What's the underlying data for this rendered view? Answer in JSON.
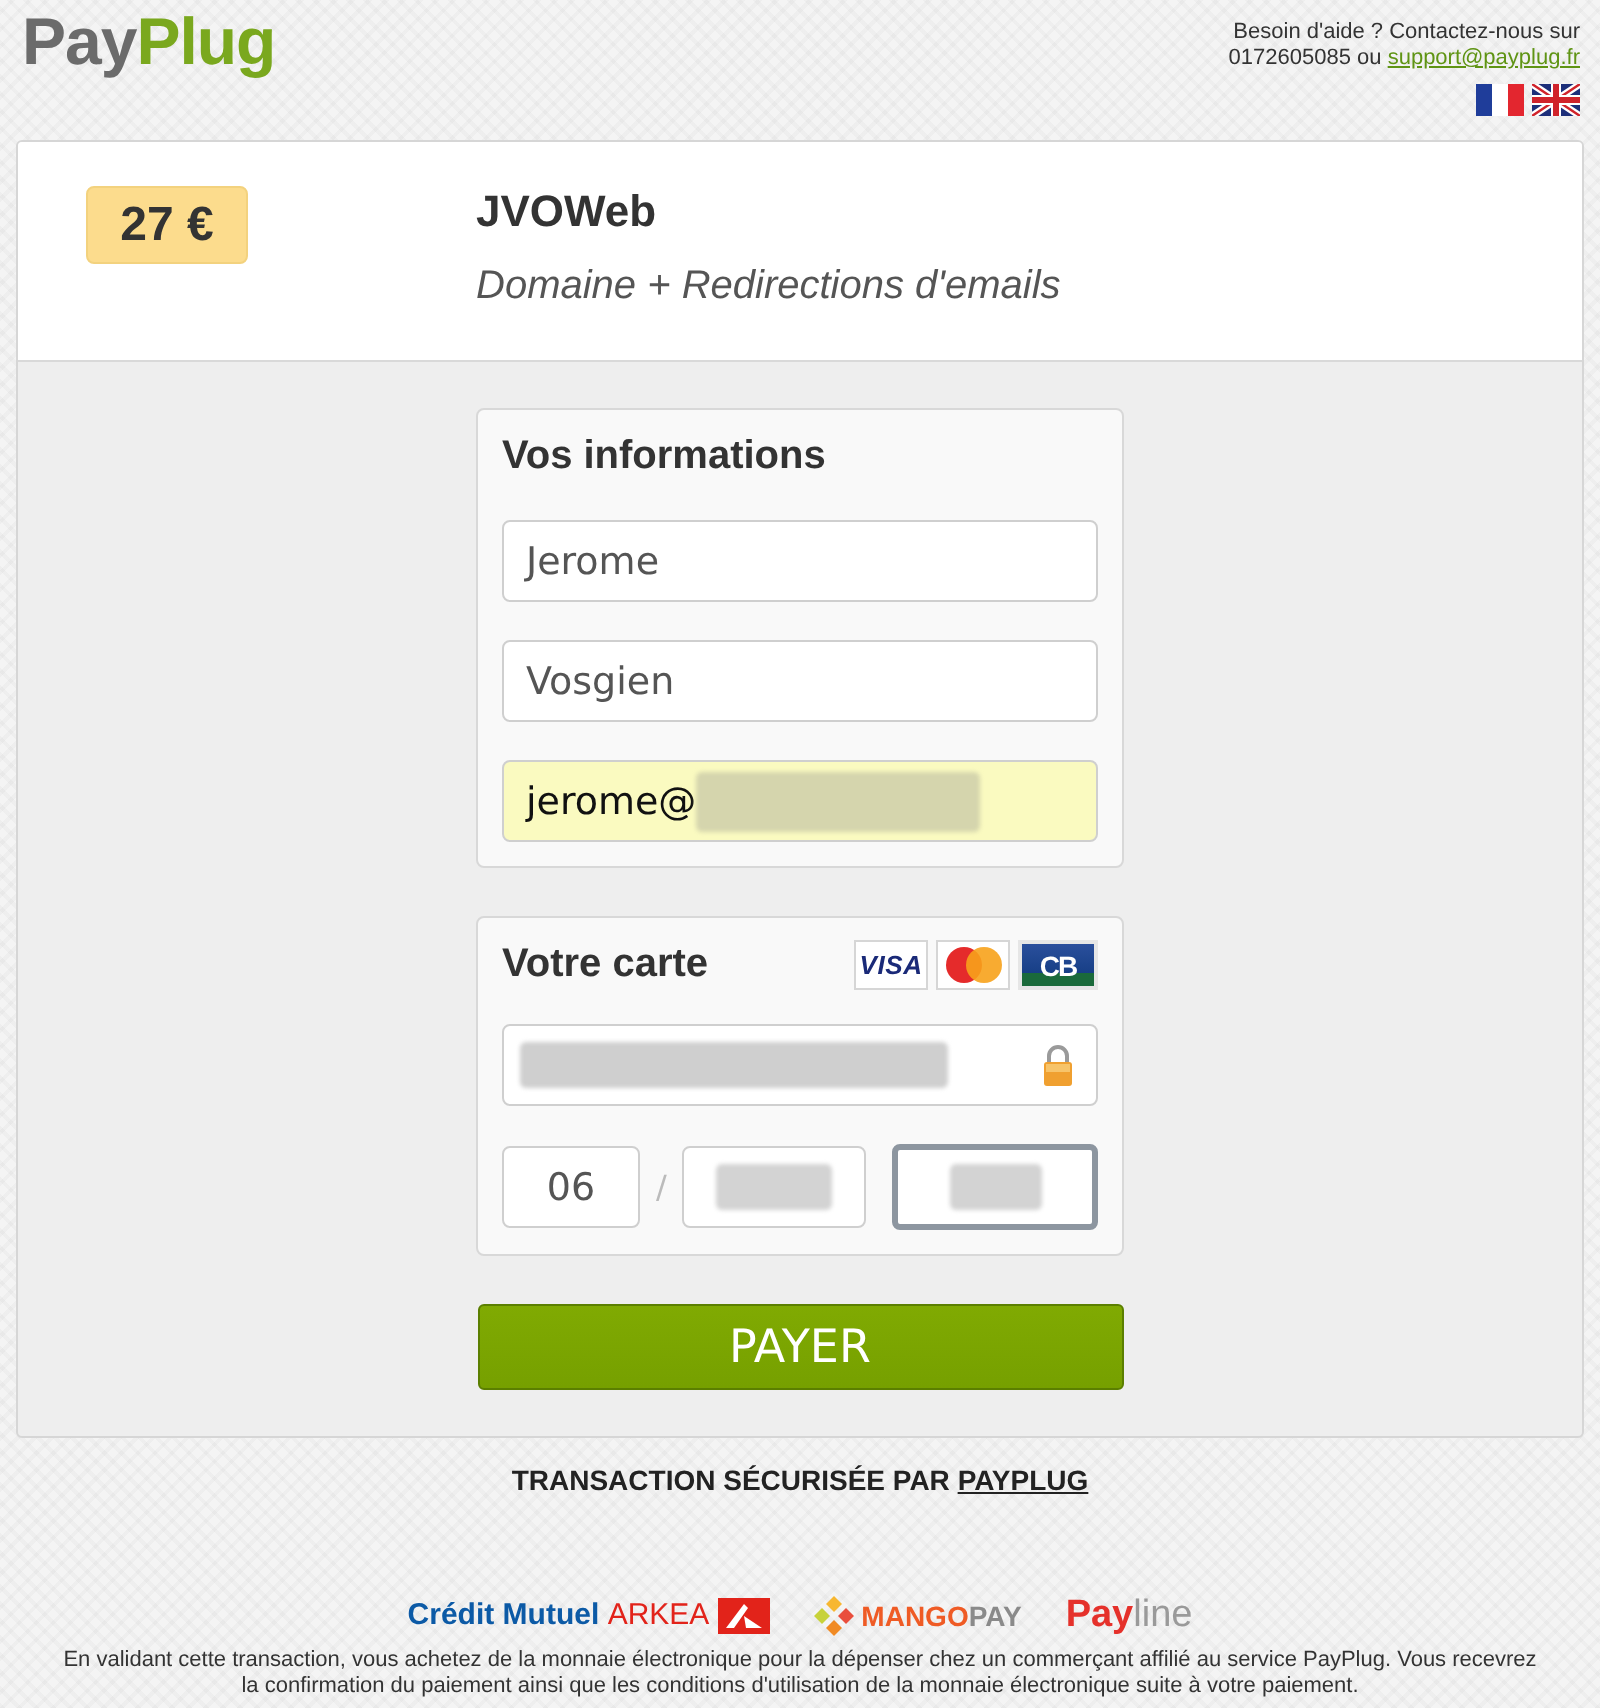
{
  "header": {
    "logo": [
      "Pay",
      "Plug"
    ],
    "help": {
      "text": "Besoin d'aide ? Contactez-nous sur 0172605085 ou",
      "link": "support@payplug.fr"
    }
  },
  "order": {
    "price": "27 €",
    "merchant": "JVOWeb",
    "description": "Domaine + Redirections d'emails"
  },
  "info_panel": {
    "title": "Vos informations",
    "fields": [
      {
        "value": "Jerome",
        "autofilled": false,
        "redacted": false
      },
      {
        "value": "Vosgien",
        "autofilled": false,
        "redacted": false
      },
      {
        "value": "jerome@",
        "autofilled": true,
        "redacted": true
      }
    ]
  },
  "card_panel": {
    "title": "Votre carte",
    "brands": [
      {
        "kind": "visa",
        "label": "VISA"
      },
      {
        "kind": "mastercard"
      },
      {
        "kind": "cb",
        "label": "CB"
      }
    ],
    "card_number": {
      "redacted": true,
      "focused": false
    },
    "expiry": {
      "month": {
        "value": "06",
        "focused": false
      },
      "separator": "/",
      "year": {
        "redacted": true,
        "focused": false
      }
    },
    "cvv": {
      "redacted": true,
      "focused": true
    }
  },
  "pay_button": "PAYER",
  "security": {
    "text": "TRANSACTION SÉCURISÉE PAR",
    "link": "PAYPLUG"
  },
  "partners": [
    {
      "kind": "credit_mutuel_arkea",
      "parts": [
        "Crédit Mutuel",
        "ARKEA"
      ]
    },
    {
      "kind": "mangopay",
      "parts": [
        "MANGO",
        "PAY"
      ]
    },
    {
      "kind": "payline",
      "parts": [
        "Pay",
        "line"
      ]
    }
  ],
  "disclaimer": "En validant cette transaction, vous achetez de la monnaie électronique pour la dépenser chez un commerçant affilié au service PayPlug. Vous recevrez la confirmation du paiement ainsi que les conditions d'utilisation de la monnaie électronique suite à votre paiement."
}
